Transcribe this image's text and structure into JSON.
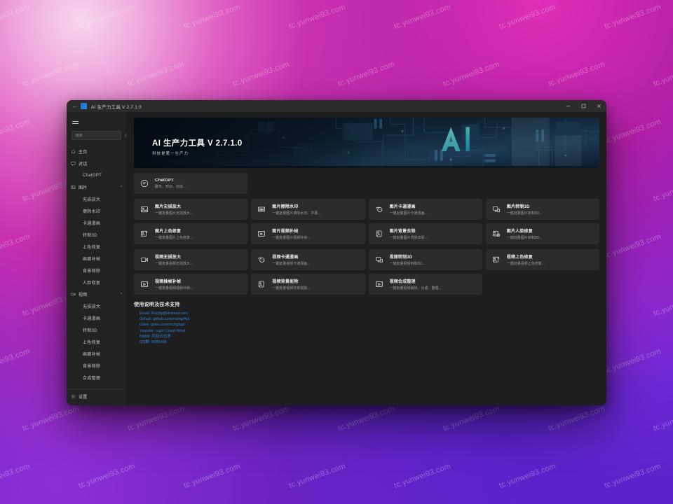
{
  "desktop": {
    "watermark_text": "tc.yunwei93.com"
  },
  "titlebar": {
    "back_icon": "back-arrow-icon",
    "app_title": "AI 生产力工具 V 2.7.1.0",
    "minimize_label": "–",
    "maximize_label": "☐",
    "close_label": "✕"
  },
  "sidebar": {
    "menu_icon": "hamburger-icon",
    "search": {
      "placeholder": "搜索",
      "value": "",
      "icon": "search-icon"
    },
    "items": [
      {
        "label": "主页",
        "icon": "home-icon",
        "level": "top",
        "expandable": false
      },
      {
        "label": "对话",
        "icon": "chat-icon",
        "level": "top",
        "expandable": false
      },
      {
        "label": "ChatGPT",
        "icon": "",
        "level": "sub"
      },
      {
        "label": "图片",
        "icon": "image-icon",
        "level": "top",
        "expandable": true,
        "chevron": "⌃"
      },
      {
        "label": "无损放大",
        "icon": "",
        "level": "sub"
      },
      {
        "label": "擦除水印",
        "icon": "",
        "level": "sub"
      },
      {
        "label": "卡通漫画",
        "icon": "",
        "level": "sub"
      },
      {
        "label": "转制3D",
        "icon": "",
        "level": "sub"
      },
      {
        "label": "上色修复",
        "icon": "",
        "level": "sub"
      },
      {
        "label": "画面补帧",
        "icon": "",
        "level": "sub"
      },
      {
        "label": "背景移除",
        "icon": "",
        "level": "sub"
      },
      {
        "label": "人脸修复",
        "icon": "",
        "level": "sub"
      },
      {
        "label": "视频",
        "icon": "video-icon",
        "level": "top",
        "expandable": true,
        "chevron": "⌃"
      },
      {
        "label": "无损放大",
        "icon": "",
        "level": "sub"
      },
      {
        "label": "卡通漫画",
        "icon": "",
        "level": "sub"
      },
      {
        "label": "转制3D",
        "icon": "",
        "level": "sub"
      },
      {
        "label": "上色修复",
        "icon": "",
        "level": "sub"
      },
      {
        "label": "画面补帧",
        "icon": "",
        "level": "sub"
      },
      {
        "label": "背景移除",
        "icon": "",
        "level": "sub"
      },
      {
        "label": "合成整理",
        "icon": "",
        "level": "sub"
      }
    ],
    "settings": {
      "label": "设置",
      "icon": "gear-icon"
    }
  },
  "banner": {
    "title": "AI 生产力工具 V 2.7.1.0",
    "subtitle": "科技是第一生产力"
  },
  "chat_card": {
    "title": "ChatGPT",
    "desc": "聊天、知识、创造...",
    "icon": "chat-bubble-icon"
  },
  "image_cards": [
    {
      "title": "图片无损放大",
      "desc": "一键批量图片无损放大...",
      "icon": "image-icon"
    },
    {
      "title": "图片擦除水印",
      "desc": "一键批量图片擦除水印、字幕...",
      "icon": "watermark-icon"
    },
    {
      "title": "图片卡通漫画",
      "desc": "一键批量图片卡通漫画...",
      "icon": "cartoon-face-icon"
    },
    {
      "title": "图片转制3D",
      "desc": "一键批量图片转制3D...",
      "icon": "monitor-3d-icon"
    },
    {
      "title": "图片上色修复",
      "desc": "一键批量图片上色修复...",
      "icon": "image-plus-icon"
    },
    {
      "title": "图片视频补帧",
      "desc": "一键批量图片视频补帧...",
      "icon": "film-play-icon"
    },
    {
      "title": "图片背景去除",
      "desc": "一键批量图片背景去除...",
      "icon": "image-cut-icon"
    },
    {
      "title": "图片人脸修复",
      "desc": "一键批量图片转制3D...",
      "icon": "face-repair-icon"
    }
  ],
  "video_cards": [
    {
      "title": "视频无损放大",
      "desc": "一键批量视频无损放大...",
      "icon": "video-camera-icon"
    },
    {
      "title": "视频卡通漫画",
      "desc": "一键批量视频卡通漫画...",
      "icon": "cartoon-face-icon"
    },
    {
      "title": "视频转制3D",
      "desc": "一键批量视频转制3D...",
      "icon": "monitor-3d-icon"
    },
    {
      "title": "视频上色修复",
      "desc": "一键批量视频上色修复...",
      "icon": "image-plus-icon"
    },
    {
      "title": "视频插帧补帧",
      "desc": "一键批量视频插帧补帧...",
      "icon": "film-play-icon"
    },
    {
      "title": "视频背景抠除",
      "desc": "一键批量视频背景抠除...",
      "icon": "image-cut-icon"
    },
    {
      "title": "视频合成整理",
      "desc": "一键批量视频解帧、合成、整理...",
      "icon": "film-play-icon"
    }
  ],
  "support": {
    "heading": "使用说明及技术支持",
    "links": [
      "Email: Rnchg@Hotmail.com",
      "Github: github.com/rnchg/Apt",
      "Gitee: gitee.com/rnchg/apt",
      "Youtube: Light Cloud Wind",
      "Bilibili: 风轻云也净",
      "QQ群: 6085398"
    ]
  }
}
